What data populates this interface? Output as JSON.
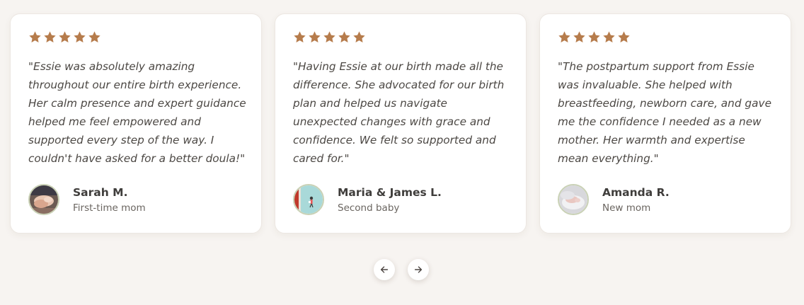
{
  "colors": {
    "background": "#f7f4f1",
    "card": "#ffffff",
    "star": "#b67c4c",
    "avatar_border": "#c9d1b5"
  },
  "testimonials": [
    {
      "rating": 5,
      "quote": "\"Essie was absolutely amazing throughout our entire birth experience. Her calm presence and expert guidance helped me feel empowered and supported every step of the way. I couldn't have asked for a better doula!\"",
      "name": "Sarah M.",
      "role": "First-time mom",
      "avatar_icon": "hands-photo-avatar"
    },
    {
      "rating": 5,
      "quote": "\"Having Essie at our birth made all the difference. She advocated for our birth plan and helped us navigate unexpected changes with grace and confidence. We felt so supported and cared for.\"",
      "name": "Maria & James L.",
      "role": "Second baby",
      "avatar_icon": "couple-photo-avatar"
    },
    {
      "rating": 5,
      "quote": "\"The postpartum support from Essie was invaluable. She helped with breastfeeding, newborn care, and gave me the confidence I needed as a new mother. Her warmth and expertise mean everything.\"",
      "name": "Amanda R.",
      "role": "New mom",
      "avatar_icon": "newborn-photo-avatar"
    }
  ],
  "navigation": {
    "prev_icon": "arrow-left-icon",
    "next_icon": "arrow-right-icon"
  }
}
